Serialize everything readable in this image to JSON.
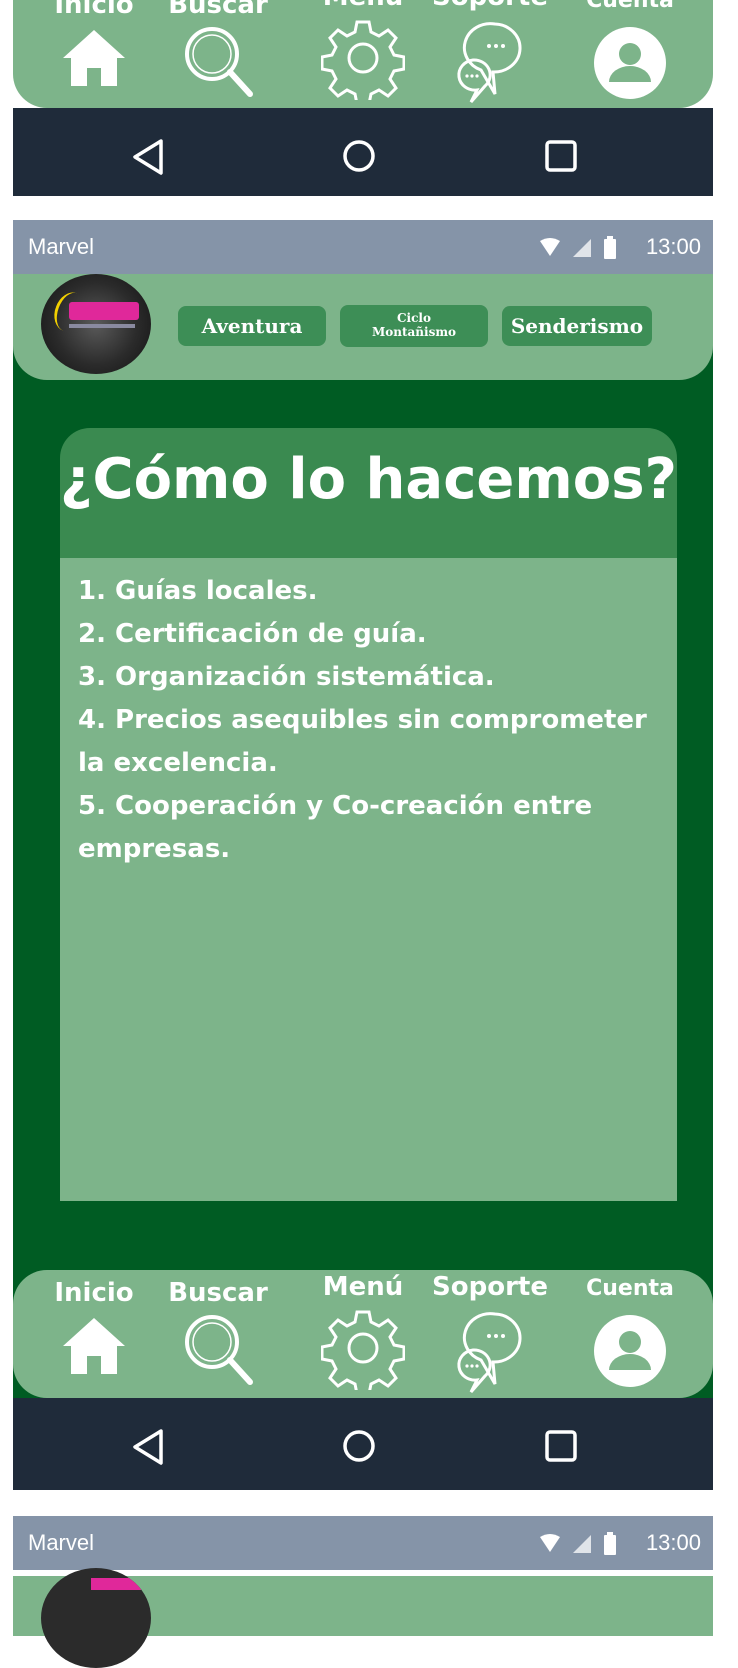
{
  "top_partial": {
    "nav_items": [
      {
        "label": "Inicio",
        "icon": "home-icon"
      },
      {
        "label": "Buscar",
        "icon": "search-icon"
      },
      {
        "label": "Menú",
        "icon": "gear-icon"
      },
      {
        "label": "Soporte",
        "icon": "chat-icon"
      },
      {
        "label": "Cuenta",
        "icon": "account-icon"
      }
    ]
  },
  "status_bar": {
    "carrier": "Marvel",
    "time": "13:00"
  },
  "header": {
    "categories": [
      "Aventura",
      "Ciclo\nMontañismo",
      "Senderismo"
    ]
  },
  "card": {
    "title": "¿Cómo lo hacemos?",
    "items": [
      "1. Guías locales.",
      "2. Certificación de guía.",
      "3. Organización sistemática.",
      "4. Precios asequibles sin comprometer la excelencia.",
      "5. Cooperación y Co-creación entre empresas."
    ]
  },
  "bottom_nav": {
    "items": [
      {
        "label": "Inicio",
        "icon": "home-icon"
      },
      {
        "label": "Buscar",
        "icon": "search-icon"
      },
      {
        "label": "Menú",
        "icon": "gear-icon"
      },
      {
        "label": "Soporte",
        "icon": "chat-icon"
      },
      {
        "label": "Cuenta",
        "icon": "account-icon"
      }
    ]
  },
  "colors": {
    "screen_bg": "#005c23",
    "panel": "#7db48a",
    "button": "#3d8e56",
    "status_bar": "#8594a8",
    "system_nav": "#1f2b3a"
  }
}
